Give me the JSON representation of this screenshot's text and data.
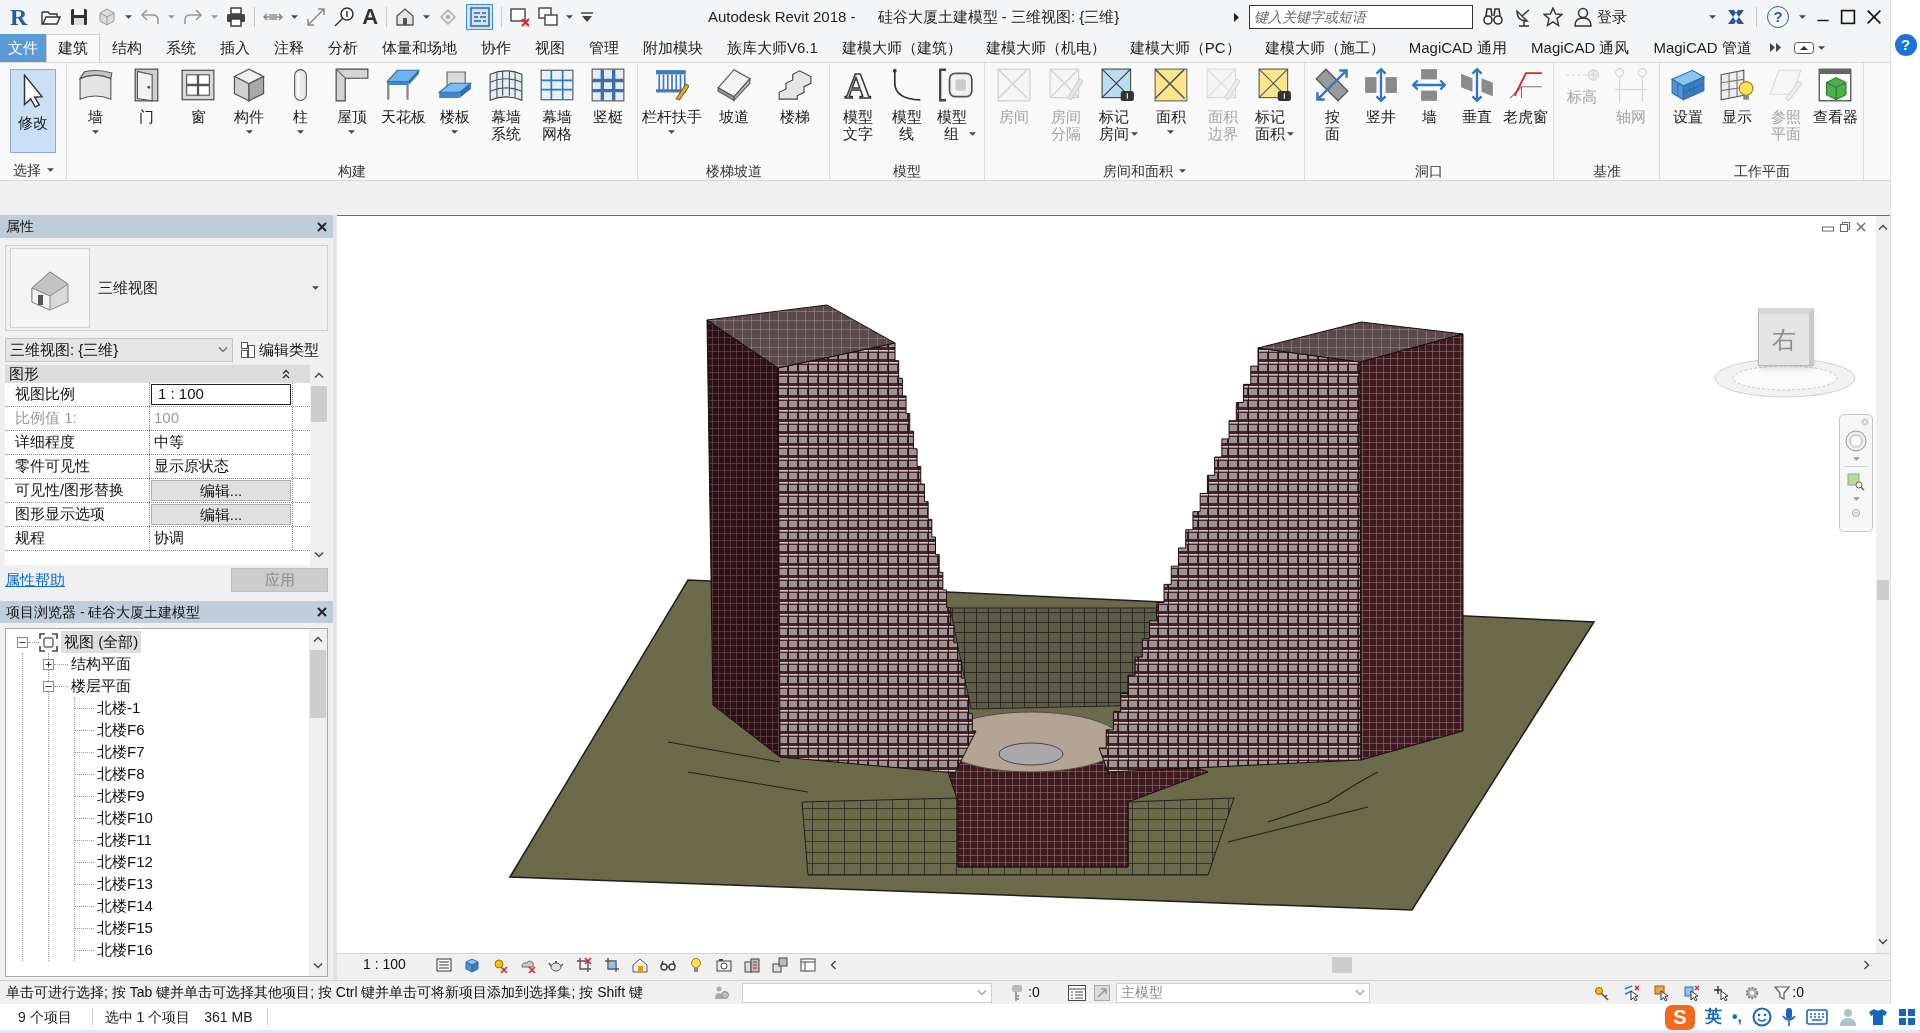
{
  "title_bar": {
    "app_logo": "R",
    "quick_access": {
      "thin_lines_on": true
    },
    "text_tool_glyph": "A",
    "app_title": "Autodesk Revit 2018 -",
    "document_title": "硅谷大厦土建模型 - 三维视图: {三维}",
    "search": {
      "placeholder": "键入关键字或短语"
    },
    "sign_in": "登录",
    "help_glyph": "?"
  },
  "ribbon": {
    "file_tab": "文件",
    "tabs": [
      {
        "label": "建筑",
        "selected": true
      },
      {
        "label": "结构",
        "selected": false
      },
      {
        "label": "系统",
        "selected": false
      },
      {
        "label": "插入",
        "selected": false
      },
      {
        "label": "注释",
        "selected": false
      },
      {
        "label": "分析",
        "selected": false
      },
      {
        "label": "体量和场地",
        "selected": false
      },
      {
        "label": "协作",
        "selected": false
      },
      {
        "label": "视图",
        "selected": false
      },
      {
        "label": "管理",
        "selected": false
      },
      {
        "label": "附加模块",
        "selected": false
      },
      {
        "label": "族库大师V6.1",
        "selected": false
      },
      {
        "label": "建模大师（建筑）",
        "selected": false
      },
      {
        "label": "建模大师（机电）",
        "selected": false
      },
      {
        "label": "建模大师（PC）",
        "selected": false
      },
      {
        "label": "建模大师（施工）",
        "selected": false
      },
      {
        "label": "MagiCAD 通用",
        "selected": false
      },
      {
        "label": "MagiCAD 通风",
        "selected": false
      },
      {
        "label": "MagiCAD 管道",
        "selected": false
      }
    ],
    "panels": [
      {
        "title": "选择",
        "menu": true,
        "buttons": [
          {
            "lines": [
              "修改"
            ],
            "active": true,
            "disabled": false,
            "dropdown": false
          }
        ]
      },
      {
        "title": "构建",
        "menu": false,
        "buttons": [
          {
            "lines": [
              "墙"
            ],
            "active": false,
            "disabled": false,
            "dropdown": true
          },
          {
            "lines": [
              "门"
            ],
            "active": false,
            "disabled": false,
            "dropdown": false
          },
          {
            "lines": [
              "窗"
            ],
            "active": false,
            "disabled": false,
            "dropdown": false
          },
          {
            "lines": [
              "构件"
            ],
            "active": false,
            "disabled": false,
            "dropdown": true
          },
          {
            "lines": [
              "柱"
            ],
            "active": false,
            "disabled": false,
            "dropdown": true
          },
          {
            "lines": [
              "屋顶"
            ],
            "active": false,
            "disabled": false,
            "dropdown": true
          },
          {
            "lines": [
              "天花板"
            ],
            "active": false,
            "disabled": false,
            "dropdown": false
          },
          {
            "lines": [
              "楼板"
            ],
            "active": false,
            "disabled": false,
            "dropdown": true
          },
          {
            "lines": [
              "幕墙",
              "系统"
            ],
            "active": false,
            "disabled": false,
            "dropdown": false
          },
          {
            "lines": [
              "幕墙",
              "网格"
            ],
            "active": false,
            "disabled": false,
            "dropdown": false
          },
          {
            "lines": [
              "竖梃"
            ],
            "active": false,
            "disabled": false,
            "dropdown": false
          }
        ]
      },
      {
        "title": "楼梯坡道",
        "menu": false,
        "buttons": [
          {
            "lines": [
              "栏杆扶手"
            ],
            "active": false,
            "disabled": false,
            "dropdown": true
          },
          {
            "lines": [
              "坡道"
            ],
            "active": false,
            "disabled": false,
            "dropdown": false
          },
          {
            "lines": [
              "楼梯"
            ],
            "active": false,
            "disabled": false,
            "dropdown": false
          }
        ]
      },
      {
        "title": "模型",
        "menu": false,
        "buttons": [
          {
            "lines": [
              "模型",
              "文字"
            ],
            "glyph": "A",
            "active": false,
            "disabled": false,
            "dropdown": false
          },
          {
            "lines": [
              "模型",
              "线"
            ],
            "active": false,
            "disabled": false,
            "dropdown": false
          },
          {
            "lines": [
              "模型",
              "组"
            ],
            "active": false,
            "disabled": false,
            "dropdown": true
          }
        ]
      },
      {
        "title": "房间和面积",
        "menu": true,
        "buttons": [
          {
            "lines": [
              "房间"
            ],
            "active": false,
            "disabled": true,
            "dropdown": false
          },
          {
            "lines": [
              "房间",
              "分隔"
            ],
            "active": false,
            "disabled": true,
            "dropdown": false
          },
          {
            "lines": [
              "标记",
              "房间"
            ],
            "active": false,
            "disabled": false,
            "dropdown": true
          },
          {
            "lines": [
              "面积"
            ],
            "active": false,
            "disabled": false,
            "dropdown": true
          },
          {
            "lines": [
              "面积",
              "边界"
            ],
            "active": false,
            "disabled": true,
            "dropdown": false
          },
          {
            "lines": [
              "标记",
              "面积"
            ],
            "active": false,
            "disabled": false,
            "dropdown": true
          }
        ]
      },
      {
        "title": "洞口",
        "menu": false,
        "buttons": [
          {
            "lines": [
              "按",
              "面"
            ],
            "active": false,
            "disabled": false,
            "dropdown": false
          },
          {
            "lines": [
              "竖井"
            ],
            "active": false,
            "disabled": false,
            "dropdown": false
          },
          {
            "lines": [
              "墙"
            ],
            "active": false,
            "disabled": false,
            "dropdown": false
          },
          {
            "lines": [
              "垂直"
            ],
            "active": false,
            "disabled": false,
            "dropdown": false
          },
          {
            "lines": [
              "老虎窗"
            ],
            "active": false,
            "disabled": false,
            "dropdown": false
          }
        ]
      },
      {
        "title": "基准",
        "menu": false,
        "buttons": [
          {
            "lines": [
              "标高"
            ],
            "active": false,
            "disabled": true,
            "dropdown": false
          },
          {
            "lines": [
              "轴网"
            ],
            "active": false,
            "disabled": true,
            "dropdown": false
          }
        ]
      },
      {
        "title": "工作平面",
        "menu": false,
        "buttons": [
          {
            "lines": [
              "设置"
            ],
            "active": false,
            "disabled": false,
            "dropdown": false
          },
          {
            "lines": [
              "显示"
            ],
            "active": false,
            "disabled": false,
            "dropdown": false
          },
          {
            "lines": [
              "参照",
              "平面"
            ],
            "active": false,
            "disabled": true,
            "dropdown": false
          },
          {
            "lines": [
              "查看器"
            ],
            "active": false,
            "disabled": false,
            "dropdown": false
          }
        ]
      }
    ]
  },
  "properties": {
    "title": "属性",
    "type_name": "三维视图",
    "instance_selector": "三维视图: {三维}",
    "edit_type": "编辑类型",
    "group": {
      "title": "图形",
      "expanded": true
    },
    "rows": [
      {
        "label": "视图比例",
        "value": "1 : 100",
        "kind": "input",
        "disabled": false
      },
      {
        "label": "比例值 1:",
        "value": "100",
        "kind": "text",
        "disabled": true
      },
      {
        "label": "详细程度",
        "value": "中等",
        "kind": "text",
        "disabled": false
      },
      {
        "label": "零件可见性",
        "value": "显示原状态",
        "kind": "text",
        "disabled": false
      },
      {
        "label": "可见性/图形替换",
        "value": "编辑...",
        "kind": "button",
        "disabled": false
      },
      {
        "label": "图形显示选项",
        "value": "编辑...",
        "kind": "button",
        "disabled": false
      },
      {
        "label": "规程",
        "value": "协调",
        "kind": "text",
        "disabled": false
      }
    ],
    "help_link": "属性帮助",
    "apply": {
      "label": "应用",
      "disabled": true
    }
  },
  "project_browser": {
    "title": "项目浏览器 - 硅谷大厦土建模型",
    "tree": [
      {
        "label": "视图 (全部)",
        "expanded": true,
        "selected": true,
        "children": [
          {
            "label": "结构平面",
            "expanded": false,
            "selected": false
          },
          {
            "label": "楼层平面",
            "expanded": true,
            "selected": false,
            "children": [
              {
                "label": "北楼-1",
                "selected": false
              },
              {
                "label": "北楼F6",
                "selected": false
              },
              {
                "label": "北楼F7",
                "selected": false
              },
              {
                "label": "北楼F8",
                "selected": false
              },
              {
                "label": "北楼F9",
                "selected": false
              },
              {
                "label": "北楼F10",
                "selected": false
              },
              {
                "label": "北楼F11",
                "selected": false
              },
              {
                "label": "北楼F12",
                "selected": false
              },
              {
                "label": "北楼F13",
                "selected": false
              },
              {
                "label": "北楼F14",
                "selected": false
              },
              {
                "label": "北楼F15",
                "selected": false
              },
              {
                "label": "北楼F16",
                "selected": false
              }
            ]
          }
        ]
      }
    ]
  },
  "view": {
    "view_cube_face": "右",
    "scale": "1 : 100"
  },
  "status_bar": {
    "hint": "单击可进行选择; 按 Tab 键并单击可选择其他项目; 按 Ctrl 键并单击可将新项目添加到选择集; 按 Shift 键",
    "editable_count": ":0",
    "active_workset": "主模型",
    "workset_disabled": true,
    "filter_count": ":0"
  },
  "footer": {
    "items": "9 个项目",
    "selection": "选中 1 个项目",
    "memory": "361 MB"
  },
  "ime_bar": {
    "logo": "S",
    "mode": "英",
    "punctuation": "•,"
  },
  "side_strip": {
    "help_glyph": "?"
  }
}
